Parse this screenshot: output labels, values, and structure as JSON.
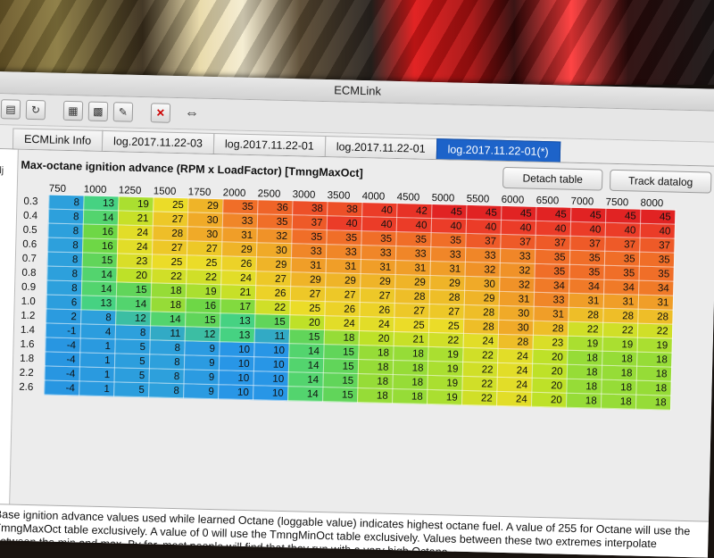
{
  "window": {
    "title": "ECMLink"
  },
  "toolbar": {
    "arrows_icon": "⇔"
  },
  "tabs": [
    {
      "label": "ECMLink Info"
    },
    {
      "label": "log.2017.11.22-03"
    },
    {
      "label": "log.2017.11.22-01"
    },
    {
      "label": "log.2017.11.22-01"
    },
    {
      "label": "log.2017.11.22-01(*)"
    }
  ],
  "panel": {
    "title": "Max-octane ignition advance (RPM x LoadFactor) [TmngMaxOct]",
    "detach_label": "Detach table",
    "track_label": "Track datalog"
  },
  "table": {
    "rpm": [
      "750",
      "1000",
      "1250",
      "1500",
      "1750",
      "2000",
      "2500",
      "3000",
      "3500",
      "4000",
      "4500",
      "5000",
      "5500",
      "6000",
      "6500",
      "7000",
      "7500",
      "8000"
    ],
    "load": [
      "0.3",
      "0.4",
      "0.5",
      "0.6",
      "0.7",
      "0.8",
      "0.9",
      "1.0",
      "1.2",
      "1.4",
      "1.6",
      "1.8",
      "2.2",
      "2.6"
    ],
    "values": [
      [
        8,
        13,
        19,
        25,
        29,
        35,
        36,
        38,
        38,
        40,
        42,
        45,
        45,
        45,
        45,
        45,
        45,
        45
      ],
      [
        8,
        14,
        21,
        27,
        30,
        33,
        35,
        37,
        40,
        40,
        40,
        40,
        40,
        40,
        40,
        40,
        40,
        40
      ],
      [
        8,
        16,
        24,
        28,
        30,
        31,
        32,
        35,
        35,
        35,
        35,
        35,
        37,
        37,
        37,
        37,
        37,
        37
      ],
      [
        8,
        16,
        24,
        27,
        27,
        29,
        30,
        33,
        33,
        33,
        33,
        33,
        33,
        33,
        35,
        35,
        35,
        35
      ],
      [
        8,
        15,
        23,
        25,
        25,
        26,
        29,
        31,
        31,
        31,
        31,
        31,
        32,
        32,
        35,
        35,
        35,
        35
      ],
      [
        8,
        14,
        20,
        22,
        22,
        24,
        27,
        29,
        29,
        29,
        29,
        29,
        30,
        32,
        34,
        34,
        34,
        34
      ],
      [
        8,
        14,
        15,
        18,
        19,
        21,
        26,
        27,
        27,
        27,
        28,
        28,
        29,
        31,
        33,
        31,
        31,
        31
      ],
      [
        6,
        13,
        14,
        18,
        16,
        17,
        22,
        25,
        26,
        26,
        27,
        27,
        28,
        30,
        31,
        28,
        28,
        28
      ],
      [
        2,
        8,
        12,
        14,
        15,
        13,
        15,
        20,
        24,
        24,
        25,
        25,
        28,
        30,
        28,
        22,
        22,
        22
      ],
      [
        -1,
        4,
        8,
        11,
        12,
        13,
        11,
        15,
        18,
        20,
        21,
        22,
        24,
        28,
        23,
        19,
        19,
        19
      ],
      [
        -4,
        1,
        5,
        8,
        9,
        10,
        10,
        14,
        15,
        18,
        18,
        19,
        22,
        24,
        20,
        18,
        18,
        18
      ],
      [
        -4,
        1,
        5,
        8,
        9,
        10,
        10,
        14,
        15,
        18,
        18,
        19,
        22,
        24,
        20,
        18,
        18,
        18
      ],
      [
        -4,
        1,
        5,
        8,
        9,
        10,
        10,
        14,
        15,
        18,
        18,
        19,
        22,
        24,
        20,
        18,
        18,
        18
      ],
      [
        -4,
        1,
        5,
        8,
        9,
        10,
        10,
        14,
        15,
        18,
        18,
        19,
        22,
        24,
        20,
        18,
        18,
        18
      ]
    ]
  },
  "description": "Base ignition advance values used while learned Octane (loggable value) indicates highest octane fuel.  A value of 255 for Octane will use the TmngMaxOct table exclusively.  A value of 0 will use the TmngMinOct table exclusively.  Values between these two extremes interpolate between the min and max.  By far, most people will find that they run with a very high Octane"
}
